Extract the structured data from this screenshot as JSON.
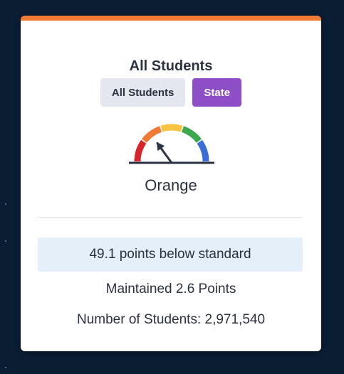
{
  "card": {
    "title": "All Students",
    "accent_color": "#f07b35",
    "tags": {
      "all_students": "All Students",
      "state": "State"
    },
    "gauge": {
      "level": "Orange",
      "level_index": 2,
      "levels_total": 5,
      "segment_colors": [
        "#d7262b",
        "#f07b35",
        "#f6c343",
        "#3ba74f",
        "#3b6dd6"
      ]
    },
    "status": "49.1 points below standard",
    "change": "Maintained 2.6 Points",
    "student_count": "Number of Students: 2,971,540"
  }
}
